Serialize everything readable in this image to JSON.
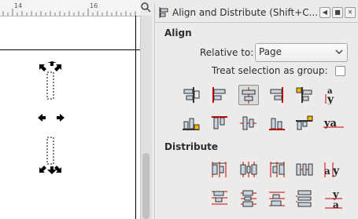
{
  "ruler": {
    "marks": [
      "14",
      "16"
    ]
  },
  "panel": {
    "title": "Align and Distribute (Shift+C...",
    "align_section": "Align",
    "relative_to_label": "Relative to:",
    "relative_to_value": "Page",
    "treat_group_label": "Treat selection as group:",
    "treat_group_checked": false,
    "distribute_section": "Distribute",
    "text_glyph_a": "a",
    "text_glyph_y": "y",
    "text_glyph_ya": "ya"
  },
  "colors": {
    "accent_red": "#cc0000",
    "box_fill": "#c8d4e0",
    "highlight_orange": "#f5b800"
  }
}
